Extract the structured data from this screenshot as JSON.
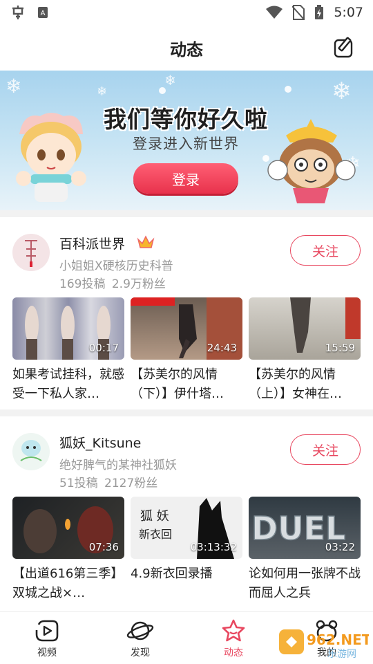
{
  "status_bar": {
    "time": "5:07"
  },
  "header": {
    "title": "动态"
  },
  "banner": {
    "headline": "我们等你好久啦",
    "subtitle": "登录进入新世界",
    "login_label": "登录"
  },
  "feed": [
    {
      "name": "百科派世界",
      "desc": "小姐姐X硬核历史科普",
      "stats": "169投稿 2.9万粉丝",
      "follow_label": "关注",
      "videos": [
        {
          "duration": "00:17",
          "title": "如果考试挂科，就感受一下私人家…"
        },
        {
          "duration": "24:43",
          "title": "【苏美尔的风情（下）】伊什塔…"
        },
        {
          "duration": "15:59",
          "title": "【苏美尔的风情（上）】女神在…"
        }
      ]
    },
    {
      "name": "狐妖_Kitsune",
      "desc": "绝好脾气的某神社狐妖",
      "stats": "51投稿 2127粉丝",
      "follow_label": "关注",
      "videos": [
        {
          "duration": "07:36",
          "title": "【出道616第三季】双城之战×…"
        },
        {
          "duration": "03:13:32",
          "title": "4.9新衣回录播"
        },
        {
          "duration": "03:22",
          "title": "论如何用一张牌不战而屈人之兵"
        }
      ]
    }
  ],
  "bottom_nav": [
    {
      "label": "视频",
      "icon": "video-icon"
    },
    {
      "label": "发现",
      "icon": "planet-icon"
    },
    {
      "label": "动态",
      "icon": "star-icon",
      "active": true
    },
    {
      "label": "我的",
      "icon": "profile-icon"
    }
  ],
  "watermark": {
    "text": "962.NET",
    "sub": "乐游网"
  },
  "colors": {
    "accent": "#e8475f"
  }
}
